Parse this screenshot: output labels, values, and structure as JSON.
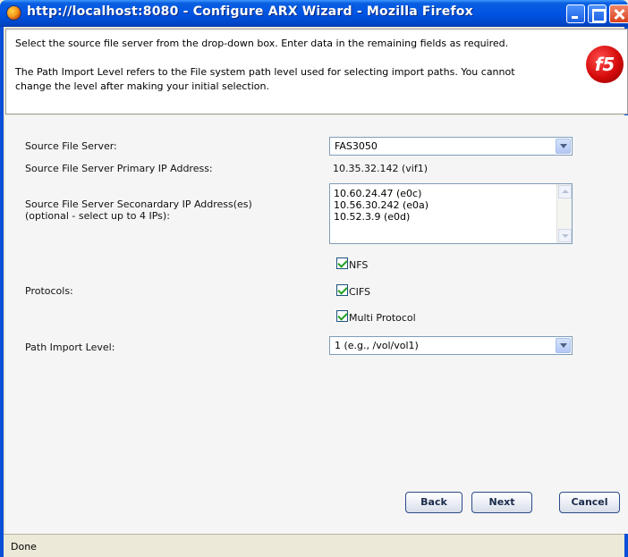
{
  "window": {
    "title": "http://localhost:8080 - Configure ARX Wizard - Mozilla Firefox"
  },
  "header": {
    "instruction_1": "Select the source file server from the drop-down box. Enter data in the remaining fields as required.",
    "instruction_2": "The Path Import Level refers to the File system path level used for selecting import paths. You cannot change the level after making your initial selection.",
    "logo_text": "f5"
  },
  "form": {
    "source_server_label": "Source File Server:",
    "source_server_value": "FAS3050",
    "primary_ip_label": "Source File Server Primary IP Address:",
    "primary_ip_value": "10.35.32.142 (vif1)",
    "secondary_ip_label_1": "Source File Server Seconardary IP Address(es)",
    "secondary_ip_label_2": "(optional - select up to 4 IPs):",
    "secondary_ips": [
      "10.60.24.47 (e0c)",
      "10.56.30.242 (e0a)",
      "10.52.3.9 (e0d)"
    ],
    "protocols_label": "Protocols:",
    "protocols": [
      {
        "label": "NFS",
        "checked": true
      },
      {
        "label": "CIFS",
        "checked": true
      },
      {
        "label": "Multi Protocol",
        "checked": true
      }
    ],
    "path_level_label": "Path Import Level:",
    "path_level_value": "1 (e.g., /vol/vol1)"
  },
  "buttons": {
    "back": "Back",
    "next": "Next",
    "cancel": "Cancel"
  },
  "status": {
    "text": "Done"
  }
}
